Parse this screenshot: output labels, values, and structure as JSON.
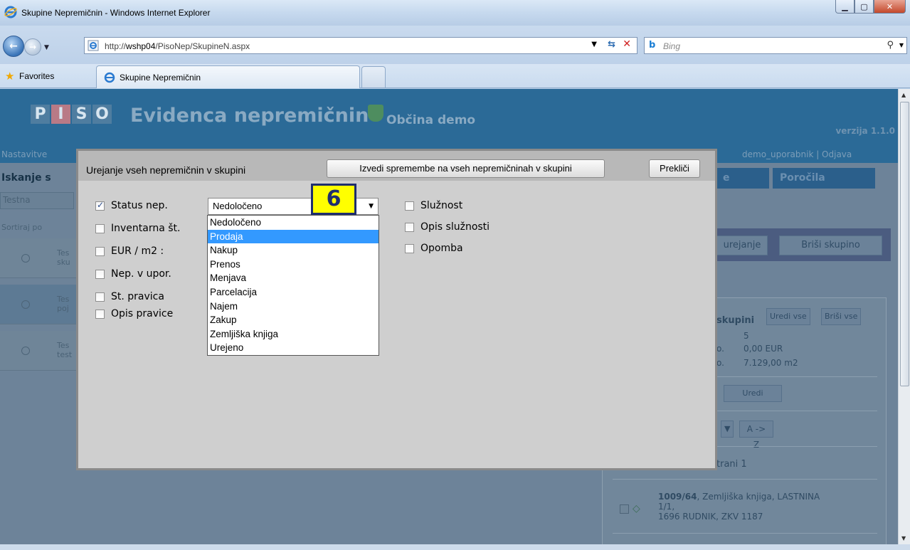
{
  "browser": {
    "window_title": "Skupine Nepremičnin - Windows Internet Explorer",
    "url_prefix": "http://",
    "url_host": "wshp04",
    "url_path": "/PisoNep/SkupineN.aspx",
    "search_placeholder": "Bing",
    "favorites_label": "Favorites",
    "tab_label": "Skupine Nepremičnin"
  },
  "app": {
    "logo_letters": [
      "P",
      "I",
      "S",
      "O"
    ],
    "title": "Evidenca nepremičnin",
    "municipality": "Občina demo",
    "version": "verzija 1.1.0",
    "nav_settings": "Nastavitve",
    "user_info": "demo_uporabnik  |  Odjava",
    "search_title": "Iskanje s",
    "search_value": "Testna",
    "sort_label": "Sortiraj po",
    "groups": [
      {
        "line1": "Tes",
        "line2": "sku"
      },
      {
        "line1": "Tes",
        "line2": "poj"
      },
      {
        "line1": "Tes",
        "line2": "test"
      }
    ],
    "right_tabs": [
      "e",
      "Poročila"
    ],
    "edit_button": "urejanje",
    "delete_group_button": "Briši skupino",
    "panel": {
      "heading": "skupini",
      "edit_all": "Uredi vse",
      "delete_all": "Briši vse",
      "count": "5",
      "value_prefix": "o.",
      "value_eur": "0,00 EUR",
      "area_prefix": "o.",
      "value_area": "7.129,00 m2",
      "edit": "Uredi",
      "sort_button": "A -> Z",
      "page_text": "trani 1",
      "record_bold": "1009/64",
      "record_line1": ", Zemljiška knjiga, LASTNINA",
      "record_line2": "1/1,",
      "record_line3": "1696 RUDNIK, ZKV 1187"
    }
  },
  "modal": {
    "title": "Urejanje vseh nepremičnin v skupini",
    "apply_button": "Izvedi spremembe na vseh nepremičninah v skupini",
    "cancel_button": "Prekliči",
    "left_fields": [
      {
        "label": "Status nep.",
        "checked": true
      },
      {
        "label": "Inventarna št.",
        "checked": false
      },
      {
        "label": "EUR / m2 :",
        "checked": false
      },
      {
        "label": "Nep. v upor.",
        "checked": false
      },
      {
        "label": "St. pravica",
        "checked": false
      },
      {
        "label": "Opis pravice",
        "checked": false
      }
    ],
    "right_fields": [
      {
        "label": "Služnost",
        "checked": false
      },
      {
        "label": "Opis služnosti",
        "checked": false
      },
      {
        "label": "Opomba",
        "checked": false
      }
    ],
    "status_selected": "Nedoločeno",
    "status_options": [
      "Nedoločeno",
      "Prodaja",
      "Nakup",
      "Prenos",
      "Menjava",
      "Parcelacija",
      "Najem",
      "Zakup",
      "Zemljiška knjiga",
      "Urejeno"
    ],
    "highlighted_option": "Prodaja",
    "step_badge": "6"
  },
  "colors": {
    "header_blue": "#2b6a97",
    "highlight": "#3399ff",
    "badge_yellow": "#ffff00"
  }
}
